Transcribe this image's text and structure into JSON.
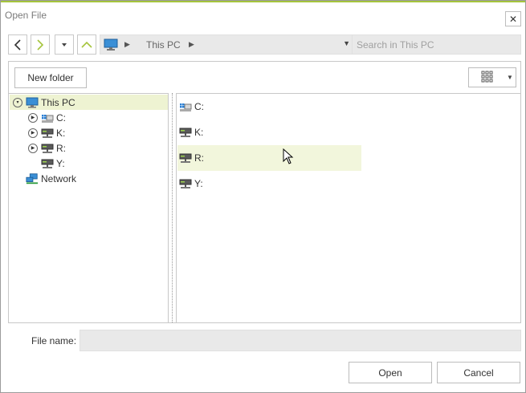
{
  "window": {
    "title": "Open File",
    "close_glyph": "✕"
  },
  "toolbar": {
    "back_icon": "chevron-left-icon",
    "forward_icon": "chevron-right-icon",
    "up_icon": "chevron-up-icon",
    "breadcrumb": [
      "This PC"
    ],
    "search_placeholder": "Search in This PC"
  },
  "actions": {
    "new_folder": "New folder"
  },
  "tree": {
    "root": {
      "label": "This PC",
      "selected": true,
      "expanded": true
    },
    "drives": [
      {
        "label": "C:",
        "icon": "system-drive-icon",
        "expandable": true
      },
      {
        "label": "K:",
        "icon": "network-drive-icon",
        "expandable": true
      },
      {
        "label": "R:",
        "icon": "network-drive-icon",
        "expandable": true
      },
      {
        "label": "Y:",
        "icon": "network-drive-icon",
        "expandable": false
      }
    ],
    "network": {
      "label": "Network",
      "icon": "network-icon"
    }
  },
  "list": {
    "items": [
      {
        "label": "C:",
        "icon": "system-drive-icon"
      },
      {
        "label": "K:",
        "icon": "network-drive-icon"
      },
      {
        "label": "R:",
        "icon": "network-drive-icon",
        "hovered": true
      },
      {
        "label": "Y:",
        "icon": "network-drive-icon"
      }
    ]
  },
  "footer": {
    "file_name_label": "File name:",
    "file_name_value": "",
    "open_label": "Open",
    "cancel_label": "Cancel"
  },
  "colors": {
    "accent": "#a5c43c",
    "selection": "#eef3d2",
    "hover": "#f2f6dc",
    "field_bg": "#e9e9e9"
  }
}
